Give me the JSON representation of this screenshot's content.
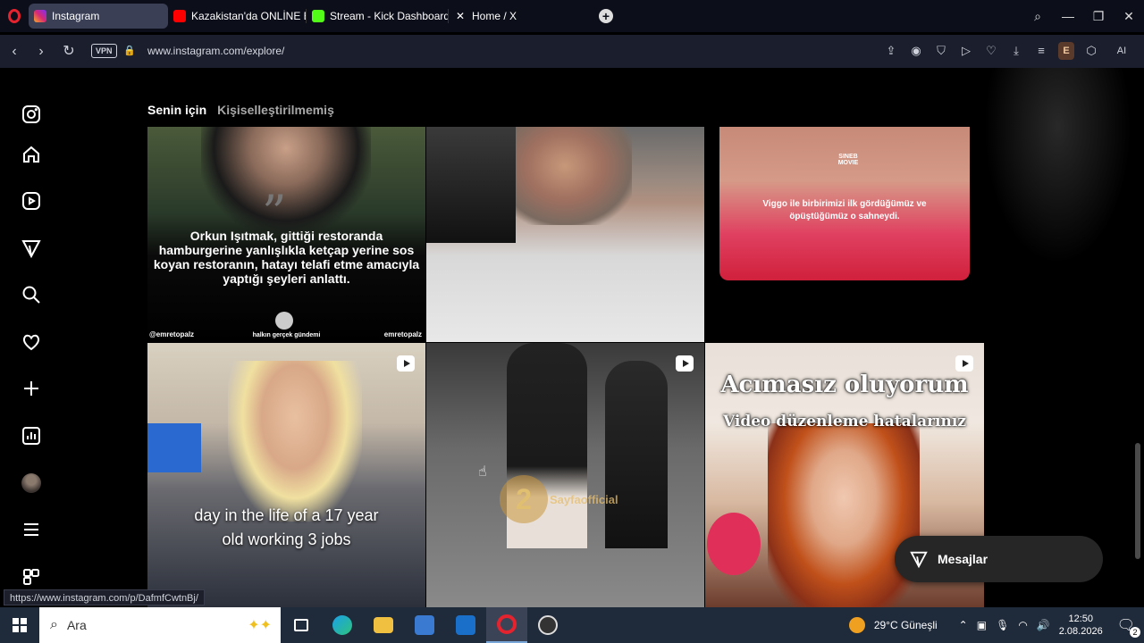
{
  "browser": {
    "tabs": [
      {
        "label": "Instagram",
        "active": true,
        "favicon_color": "#d62976"
      },
      {
        "label": "Kazakistan'da ONLİNE EV...",
        "active": false,
        "favicon_color": "#ff0000"
      },
      {
        "label": "Stream - Kick Dashboard",
        "active": false,
        "favicon_color": "#53fc18"
      },
      {
        "label": "Home / X",
        "active": false,
        "favicon_color": "#ffffff"
      }
    ],
    "new_tab_label": "+",
    "url": "www.instagram.com/explore/",
    "vpn_label": "VPN",
    "extension_label": "E",
    "ai_label": "AI"
  },
  "explore": {
    "tabs": [
      {
        "label": "Senin için",
        "selected": true
      },
      {
        "label": "Kişiselleştirilmemiş",
        "selected": false
      }
    ],
    "tiles": [
      {
        "caption": "Orkun Işıtmak, gittiği restoranda hamburgerine yanlışlıkla ketçap yerine sos koyan restoranın, hatayı telafi etme amacıyla yaptığı şeyleri anlattı.",
        "left_credit": "@emretopalz",
        "center_credit": "halkın gerçek gündemi",
        "right_credit": "emretopalz",
        "reel": false
      },
      {
        "caption": "",
        "reel": false
      },
      {
        "caption": "Viggo ile birbirimizi ilk gördüğümüz ve öpüştüğümüz o sahneydi.",
        "badge": "SINEB MOVIE",
        "reel": false
      },
      {
        "caption": "day in the life of a 17 year old working 3 jobs",
        "reel": true
      },
      {
        "caption": "",
        "watermark": "Sayfaofficial",
        "reel": true
      },
      {
        "caption": "Acımasız oluyorum",
        "subcaption": "Video düzenleme hatalarınız",
        "reel": true
      }
    ]
  },
  "messages_label": "Mesajlar",
  "status_url": "https://www.instagram.com/p/DafmfCwtnBj/",
  "taskbar": {
    "search_placeholder": "Ara",
    "weather": "29°C  Güneşli",
    "time": "12:50",
    "date": "2.08.2026",
    "notification_count": "2"
  }
}
